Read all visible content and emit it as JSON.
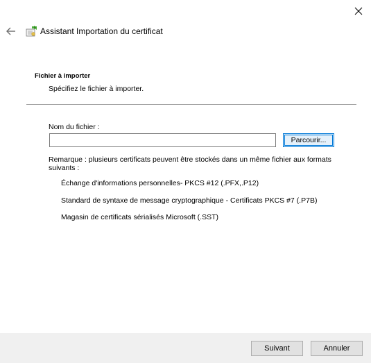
{
  "window": {
    "title": "Assistant Importation du certificat"
  },
  "icons": {
    "close": "close-icon",
    "back": "back-arrow-icon",
    "wizard": "certificate-wizard-icon"
  },
  "section": {
    "heading": "Fichier à importer",
    "subheading": "Spécifiez le fichier à importer."
  },
  "file": {
    "label": "Nom du fichier :",
    "value": "",
    "placeholder": "",
    "browse_label": "Parcourir..."
  },
  "note": "Remarque : plusieurs certificats peuvent être stockés dans un même fichier aux formats suivants :",
  "formats": [
    "Échange d'informations personnelles- PKCS #12 (.PFX,.P12)",
    "Standard de syntaxe de message cryptographique - Certificats PKCS #7 (.P7B)",
    "Magasin de certificats sérialisés Microsoft (.SST)"
  ],
  "footer": {
    "next_label": "Suivant",
    "cancel_label": "Annuler"
  },
  "colors": {
    "accent": "#0078d7",
    "footer_bg": "#f0f0f0",
    "button_bg": "#e1e1e1"
  }
}
